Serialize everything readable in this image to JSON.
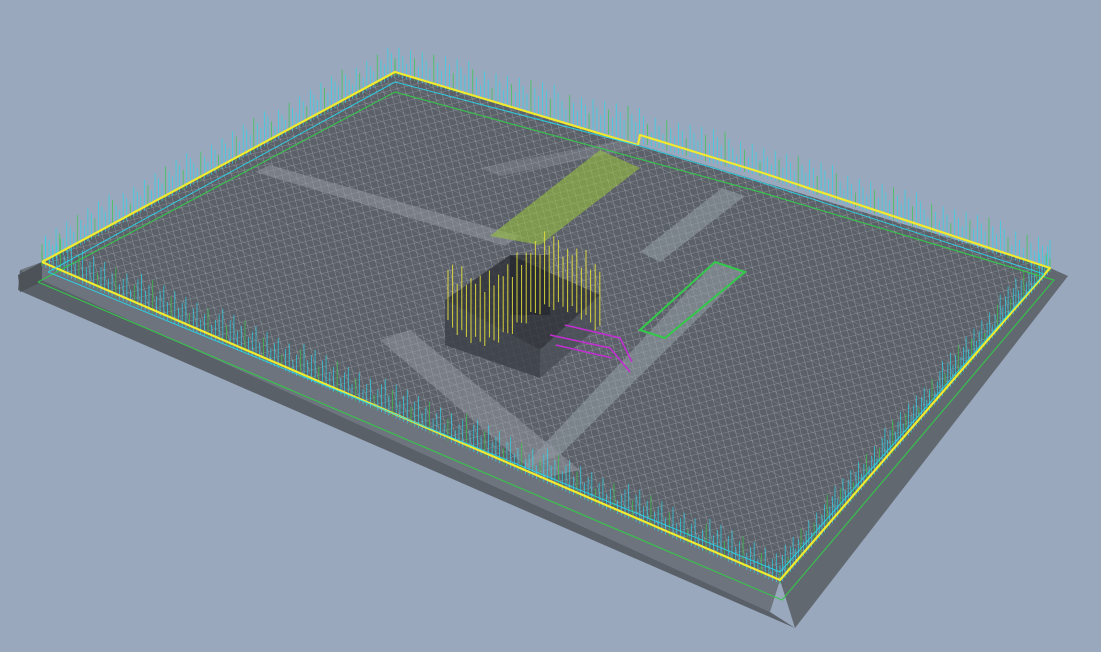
{
  "viewport": {
    "name": "3d-model-viewport",
    "background_color": "#99a8bd"
  },
  "colors": {
    "slab_top": "#5c6169",
    "slab_side_front": "#6e747d",
    "slab_side_right": "#626870",
    "slab_bottom_shade": "#3f4349",
    "mesh_line": "#e8eef5",
    "beam_light": "#9aa1aa",
    "perimeter_rebar": "#f2ea2e",
    "stirrup_cyan": "#28d6ea",
    "stirrup_green": "#33c94a",
    "core_rebar_yellow": "#e6e23a",
    "green_strip": "#9ac63a",
    "magenta_rebar": "#c22fd1"
  },
  "elements": [
    "foundation-slab",
    "top-rebar-mesh",
    "perimeter-edge-beam",
    "perimeter-stirrups",
    "internal-beams",
    "central-pit-core",
    "pit-vertical-rebar",
    "green-reinforcement-strip",
    "magenta-rebar-detail"
  ]
}
